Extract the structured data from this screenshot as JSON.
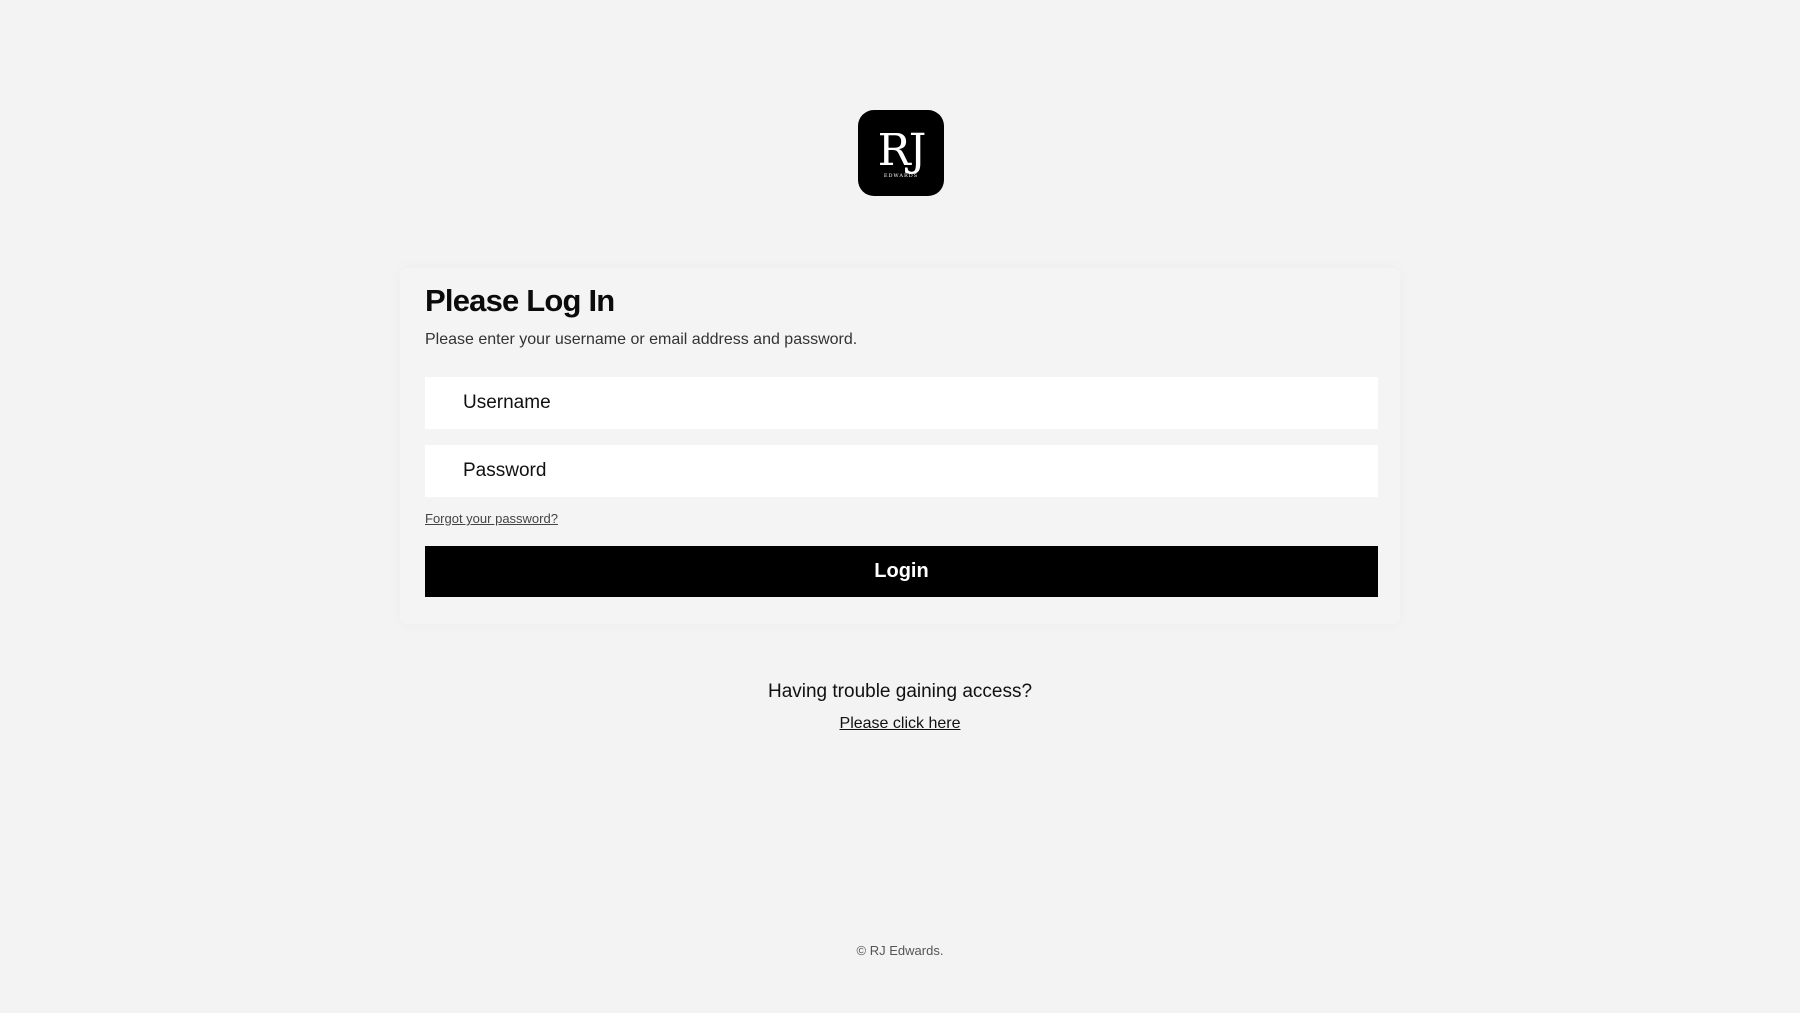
{
  "brand": {
    "logo_mark": "RJ",
    "logo_subtext": "EDWARDS",
    "logo_bg": "#000000",
    "logo_fg": "#ffffff"
  },
  "login": {
    "title": "Please Log In",
    "subtitle": "Please enter your username or email address and password.",
    "username_placeholder": "Username",
    "password_placeholder": "Password",
    "username_value": "",
    "password_value": "",
    "forgot_label": "Forgot your password?",
    "submit_label": "Login"
  },
  "help": {
    "question": "Having trouble gaining access?",
    "link_label": "Please click here"
  },
  "footer": {
    "copyright": "© RJ Edwards."
  },
  "colors": {
    "page_bg": "#f3f3f3",
    "button_bg": "#000000",
    "button_fg": "#ffffff",
    "input_bg": "#ffffff"
  }
}
